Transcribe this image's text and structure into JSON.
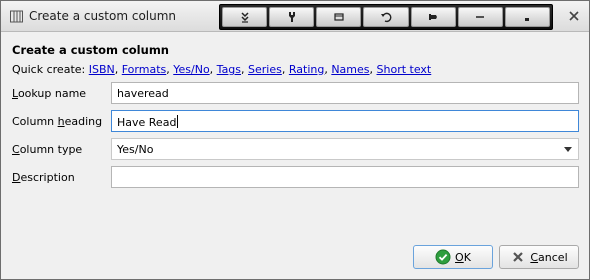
{
  "window": {
    "title": "Create a custom column",
    "icons": {
      "app": "column-icon",
      "close": "close-icon"
    }
  },
  "toolbar": {
    "buttons": [
      {
        "name": "menu-down-icon"
      },
      {
        "name": "tools-icon"
      },
      {
        "name": "window-icon"
      },
      {
        "name": "undo-icon"
      },
      {
        "name": "pin-icon"
      },
      {
        "name": "minimize-icon"
      },
      {
        "name": "dot-icon"
      }
    ]
  },
  "form": {
    "heading": "Create a custom column",
    "quick_create_label": "Quick create:",
    "quick_links": [
      "ISBN",
      "Formats",
      "Yes/No",
      "Tags",
      "Series",
      "Rating",
      "Names",
      "Short text"
    ],
    "lookup_name": {
      "label_pre": "",
      "label_mn": "L",
      "label_post": "ookup name",
      "value": "haveread"
    },
    "column_heading": {
      "label_pre": "Column ",
      "label_mn": "h",
      "label_post": "eading",
      "value": "Have Read"
    },
    "column_type": {
      "label_pre": "",
      "label_mn": "C",
      "label_post": "olumn type",
      "value": "Yes/No"
    },
    "description": {
      "label_pre": "",
      "label_mn": "D",
      "label_post": "escription",
      "value": ""
    }
  },
  "buttons": {
    "ok_mn": "O",
    "ok_post": "K",
    "cancel_mn": "C",
    "cancel_post": "ancel"
  },
  "colors": {
    "accent_focus": "#3f87d8",
    "link": "#0000cc",
    "ok_check": "#2e9e3e",
    "cancel_x": "#555555"
  }
}
